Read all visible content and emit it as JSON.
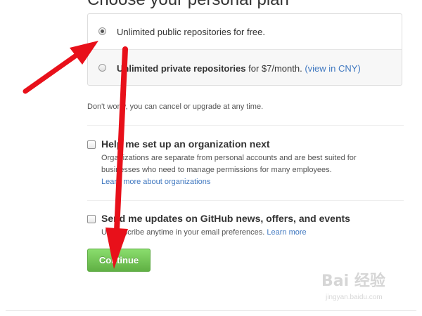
{
  "heading": "Choose your personal plan",
  "plans": [
    {
      "label": "Unlimited public repositories for free.",
      "selected": true
    },
    {
      "label_strong": "Unlimited private repositories",
      "label_rest": " for $7/month. ",
      "link": "(view in CNY)",
      "selected": false
    }
  ],
  "cancel_note": "Don't worry, you can cancel or upgrade at any time.",
  "organization": {
    "title": "Help me set up an organization next",
    "description": "Organizations are separate from personal accounts and are best suited for businesses who need to manage permissions for many employees.",
    "link": "Learn more about organizations",
    "checked": false
  },
  "updates": {
    "title": "Send me updates on GitHub news, offers, and events",
    "description": "Unsubscribe anytime in your email preferences. ",
    "link": "Learn more",
    "checked": false
  },
  "continue_label": "Continue",
  "watermark": {
    "logo": "Bai 经验",
    "url": "jingyan.baidu.com"
  },
  "colors": {
    "button_green": "#60b044",
    "link_blue": "#4078c0",
    "annotation_red": "#e8101a"
  }
}
